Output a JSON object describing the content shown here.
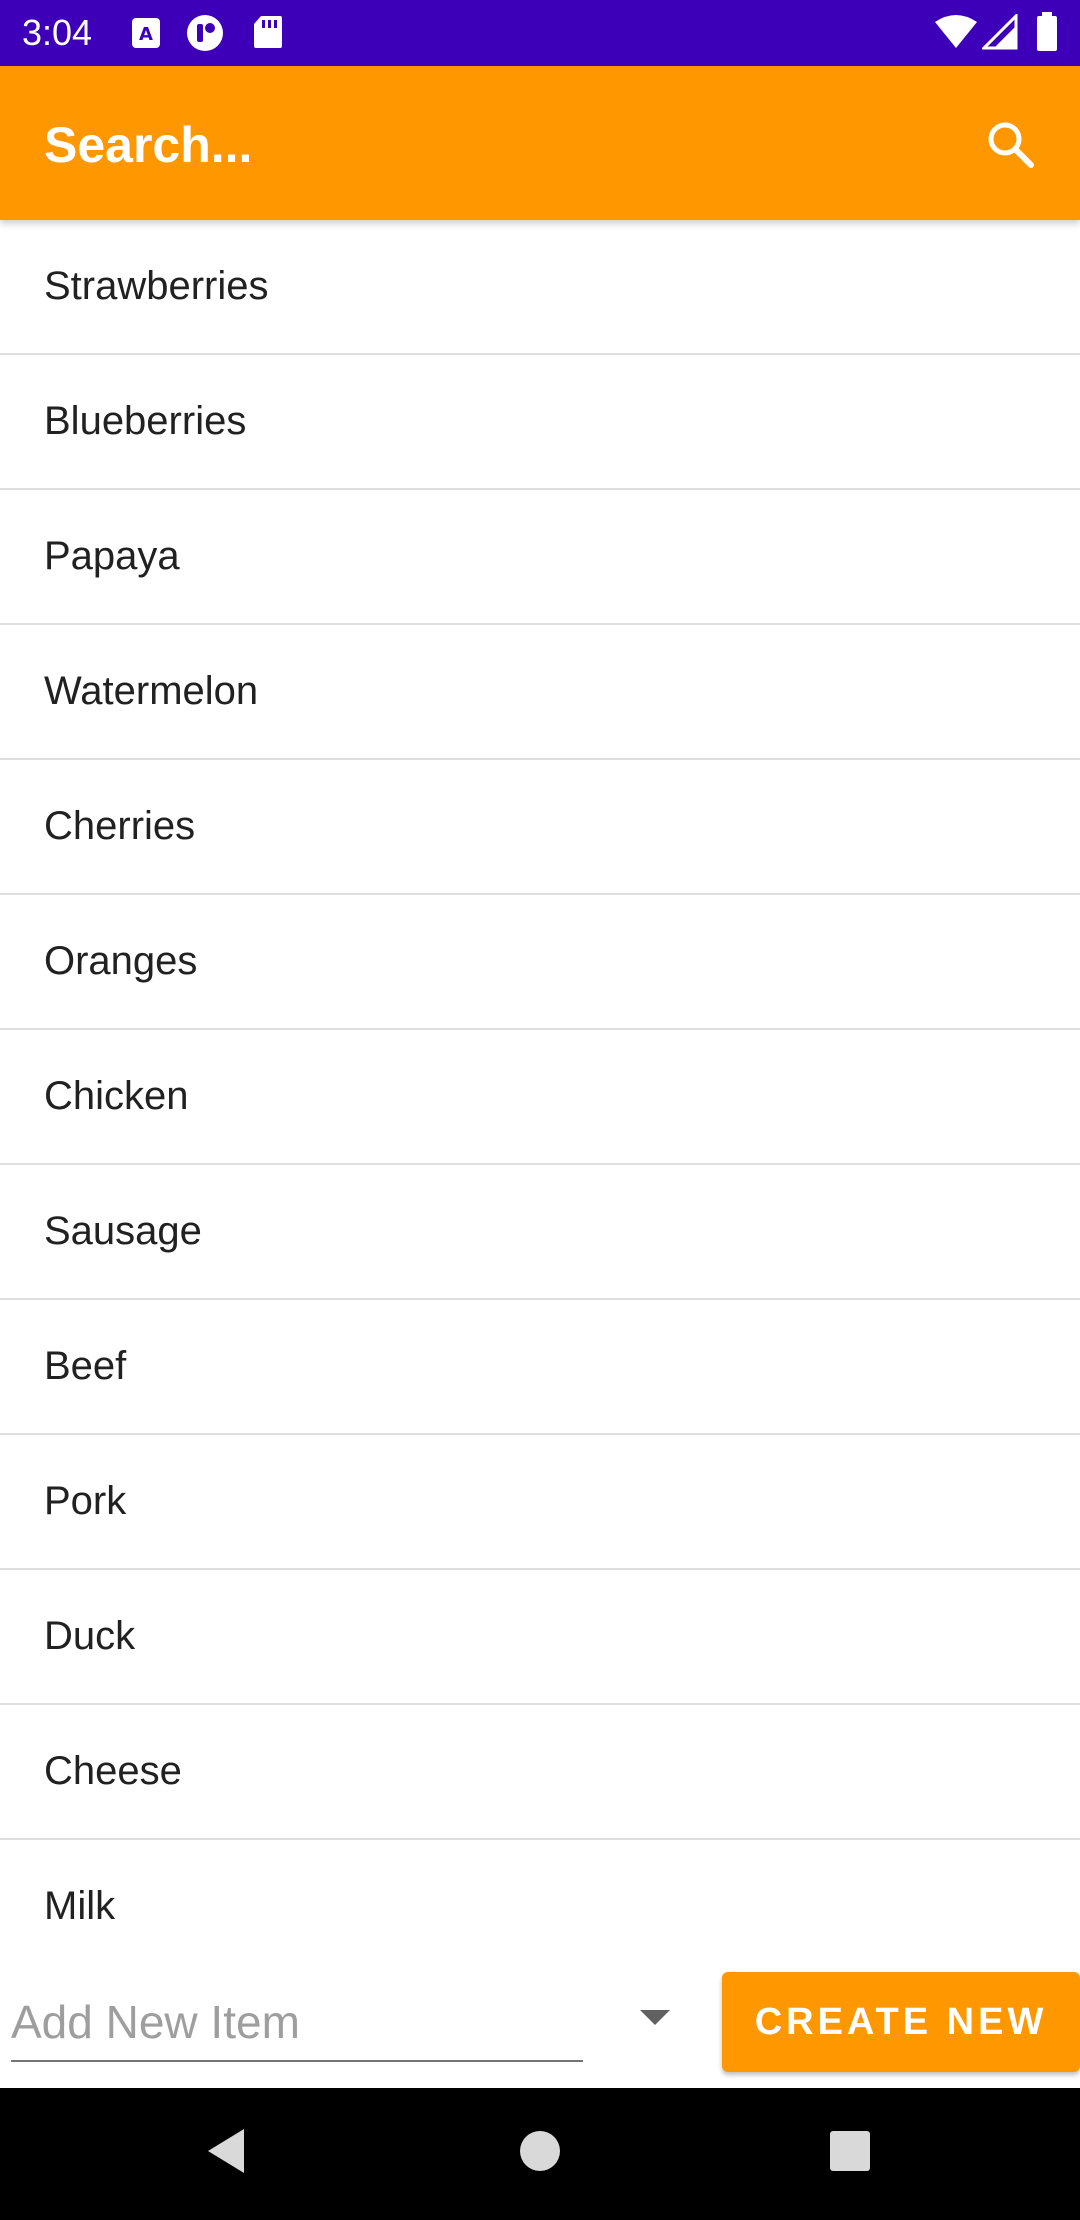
{
  "status_bar": {
    "time": "3:04",
    "icons": [
      "keyboard-a-icon",
      "app-notification-icon",
      "sd-card-icon",
      "wifi-icon",
      "signal-icon",
      "battery-icon"
    ]
  },
  "search": {
    "placeholder": "Search...",
    "icon": "search-icon"
  },
  "items": [
    "Strawberries",
    "Blueberries",
    "Papaya",
    "Watermelon",
    "Cherries",
    "Oranges",
    "Chicken",
    "Sausage",
    "Beef",
    "Pork",
    "Duck",
    "Cheese",
    "Milk"
  ],
  "add_item": {
    "placeholder": "Add New Item",
    "dropdown_icon": "dropdown-arrow-icon",
    "create_label": "CREATE NEW"
  },
  "nav": {
    "icons": [
      "back-icon",
      "home-icon",
      "recents-icon"
    ]
  },
  "colors": {
    "status_bar": "#3d00b8",
    "accent": "#ff9800",
    "nav_bar": "#000000"
  }
}
